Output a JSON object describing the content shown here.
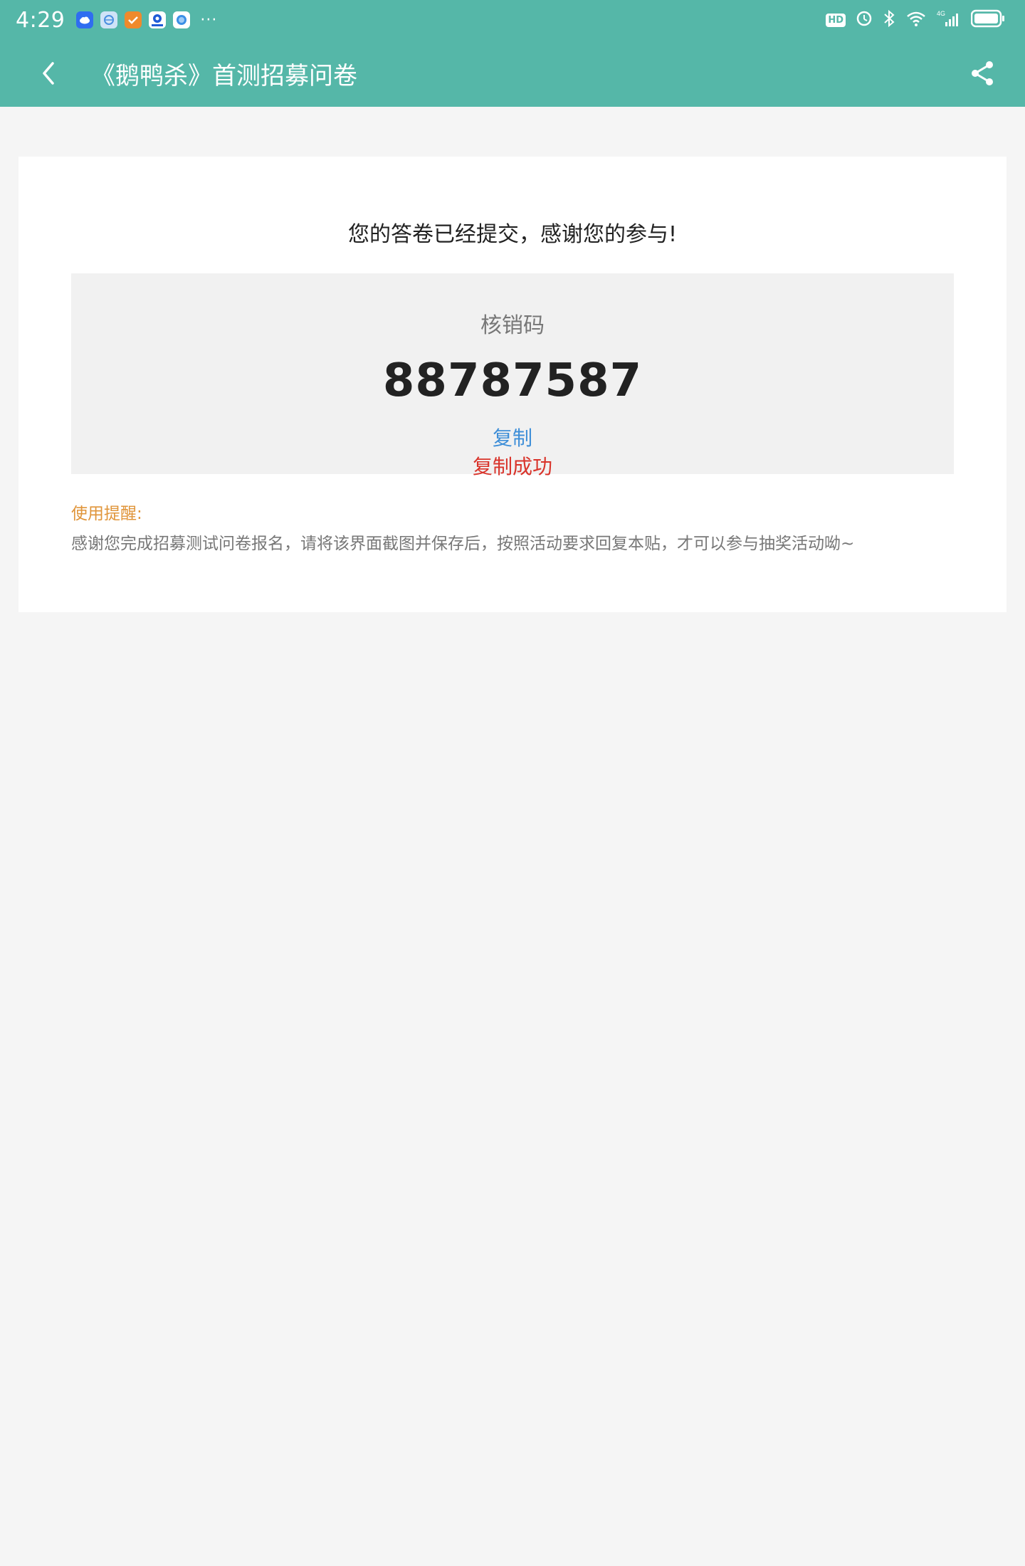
{
  "status_bar": {
    "time": "4:29",
    "overflow": "···",
    "hd_badge": "HD",
    "signal": "4G"
  },
  "app_bar": {
    "title": "《鹅鸭杀》首测招募问卷"
  },
  "result": {
    "thanks_message": "您的答卷已经提交，感谢您的参与!",
    "code_label": "核销码",
    "code_value": "88787587",
    "copy_label": "复制",
    "copy_success": "复制成功",
    "tips_label": "使用提醒:",
    "tips_text": "感谢您完成招募测试问卷报名，请将该界面截图并保存后，按照活动要求回复本贴，才可以参与抽奖活动呦~"
  },
  "colors": {
    "header": "#55b7a8",
    "link": "#3f8fd8",
    "success": "#d9342b",
    "tips_label": "#e0953a"
  },
  "icons": [
    "cloud-app-icon",
    "globe-app-icon",
    "check-app-icon",
    "map-app-icon",
    "browser-app-icon",
    "back-icon",
    "share-icon",
    "bluetooth-icon",
    "wifi-icon",
    "signal-icon",
    "battery-icon"
  ]
}
